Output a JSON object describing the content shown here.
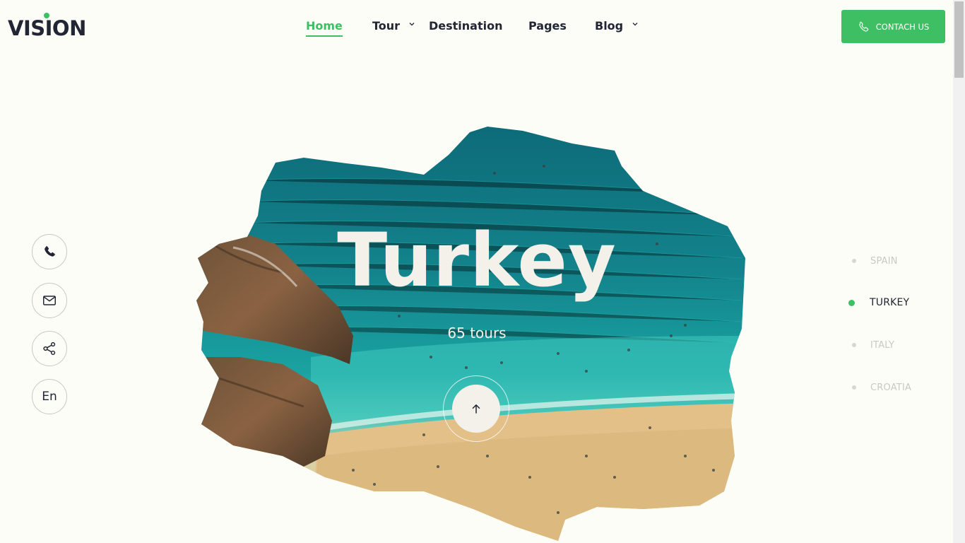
{
  "brand": {
    "logo_text": "VISION",
    "accent_color": "#3fbf63",
    "text_color": "#222533",
    "background_color": "#fdfdf7"
  },
  "nav": {
    "items": [
      {
        "label": "Home",
        "active": true,
        "has_dropdown": false
      },
      {
        "label": "Tour",
        "active": false,
        "has_dropdown": true
      },
      {
        "label": "Destination",
        "active": false,
        "has_dropdown": false
      },
      {
        "label": "Pages",
        "active": false,
        "has_dropdown": false
      },
      {
        "label": "Blog",
        "active": false,
        "has_dropdown": true
      }
    ]
  },
  "contact_button": {
    "label": "CONTACH US",
    "icon": "phone-icon"
  },
  "side_actions": [
    {
      "icon": "phone-icon"
    },
    {
      "icon": "mail-icon"
    },
    {
      "icon": "share-icon"
    },
    {
      "label": "En"
    }
  ],
  "hero": {
    "title": "Turkey",
    "subtitle": "65 tours",
    "arrow_icon": "arrow-up-icon"
  },
  "destinations": {
    "items": [
      {
        "label": "SPAIN",
        "active": false
      },
      {
        "label": "TURKEY",
        "active": true
      },
      {
        "label": "ITALY",
        "active": false
      },
      {
        "label": "CROATIA",
        "active": false
      }
    ]
  }
}
